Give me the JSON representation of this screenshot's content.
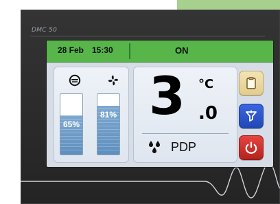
{
  "device": {
    "model": "DMC 50"
  },
  "status": {
    "date": "28 Feb",
    "time": "15:30",
    "state": "ON"
  },
  "left_panel": {
    "compressor": {
      "icon": "compressor-icon",
      "value": "65%",
      "level": 0.65
    },
    "fan": {
      "icon": "fan-icon",
      "value": "81%",
      "level": 0.81
    }
  },
  "main_value": {
    "integer": "3",
    "decimal": ".0",
    "unit": "°C",
    "label": "PDP",
    "icon": "water-drops-icon"
  },
  "actions": [
    {
      "name": "clipboard-button",
      "icon": "clipboard-icon"
    },
    {
      "name": "filter-button",
      "icon": "filter-icon"
    },
    {
      "name": "power-button",
      "icon": "power-icon"
    }
  ],
  "colors": {
    "status_bg": "#57b54a",
    "screen_bg": "#d7dde6",
    "bar_fill": "#5e8fbd",
    "filter_button": "#2248b6",
    "power_button": "#b5231e",
    "clipboard_button": "#e3cc8d"
  }
}
